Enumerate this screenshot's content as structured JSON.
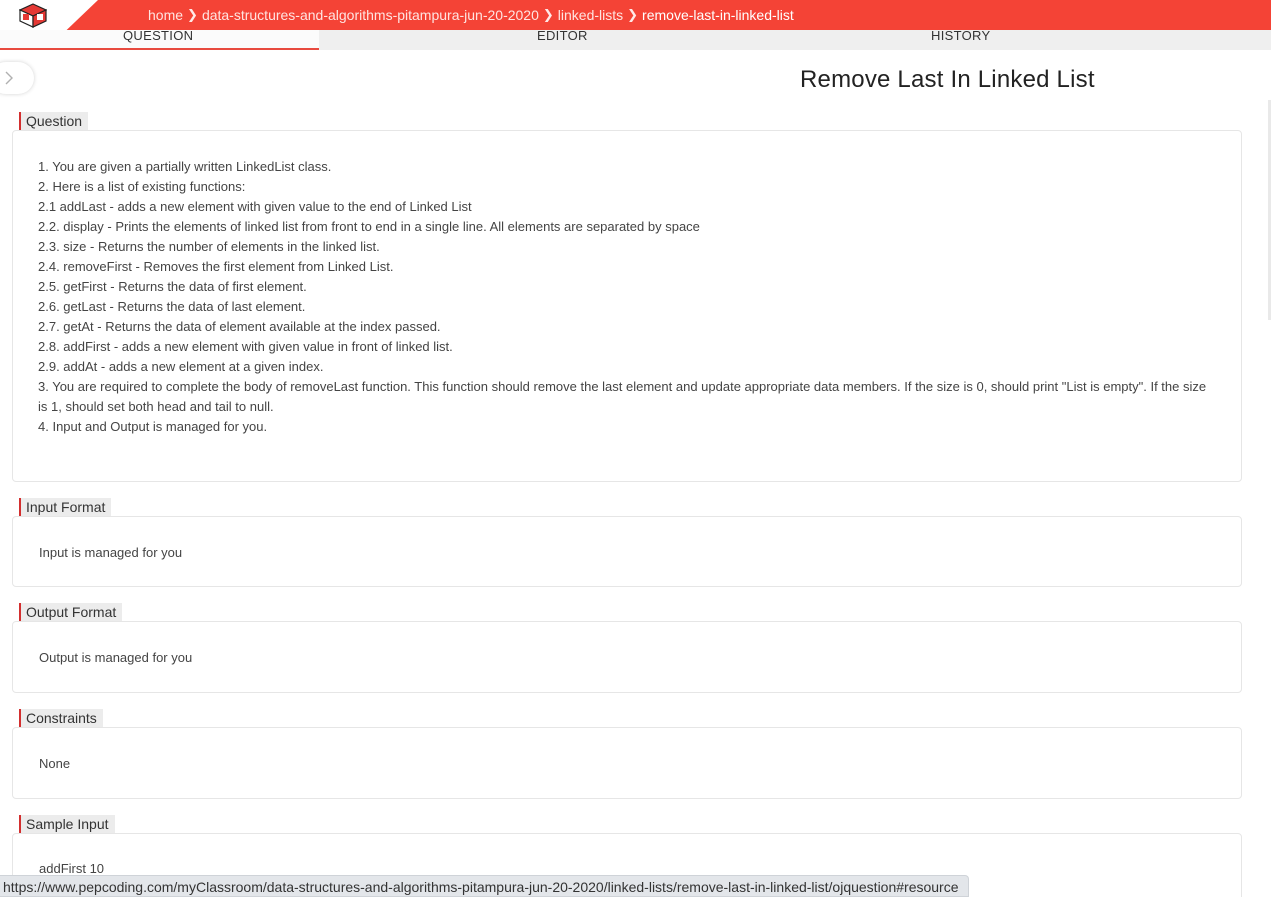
{
  "header": {
    "logo_icon": "pepcoding-logo-icon",
    "brand_color": "#f44336",
    "breadcrumbs": [
      "home",
      "data-structures-and-algorithms-pitampura-jun-20-2020",
      "linked-lists",
      "remove-last-in-linked-list"
    ]
  },
  "tabs": [
    "QUESTION",
    "EDITOR",
    "HISTORY"
  ],
  "page": {
    "title": "Remove Last In Linked List"
  },
  "sections": {
    "question": {
      "label": "Question",
      "lines": [
        "1. You are given a partially written LinkedList class.",
        "2. Here is a list of existing functions:",
        "2.1 addLast - adds a new element with given value to the end of Linked List",
        "2.2. display - Prints the elements of linked list from front to end in a single line. All elements are separated by space",
        "2.3. size - Returns the number of elements in the linked list.",
        "2.4. removeFirst - Removes the first element from Linked List.",
        "2.5. getFirst - Returns the data of first element.",
        "2.6. getLast - Returns the data of last element.",
        "2.7. getAt - Returns the data of element available at the index passed.",
        "2.8. addFirst - adds a new element with given value in front of linked list.",
        "2.9. addAt - adds a new element at a given index.",
        "3. You are required to complete the body of removeLast function. This function should remove the last element and update appropriate data members. If the size is 0, should print \"List is empty\". If the size is 1, should set both head and tail to null.",
        "4. Input and Output is managed for you."
      ]
    },
    "input_format": {
      "label": "Input Format",
      "text": "Input is managed for you"
    },
    "output_format": {
      "label": "Output Format",
      "text": "Output is managed for you"
    },
    "constraints": {
      "label": "Constraints",
      "text": "None"
    },
    "sample_input": {
      "label": "Sample Input",
      "text": "addFirst 10"
    }
  },
  "status_bar": {
    "url": "https://www.pepcoding.com/myClassroom/data-structures-and-algorithms-pitampura-jun-20-2020/linked-lists/remove-last-in-linked-list/ojquestion#resource"
  }
}
